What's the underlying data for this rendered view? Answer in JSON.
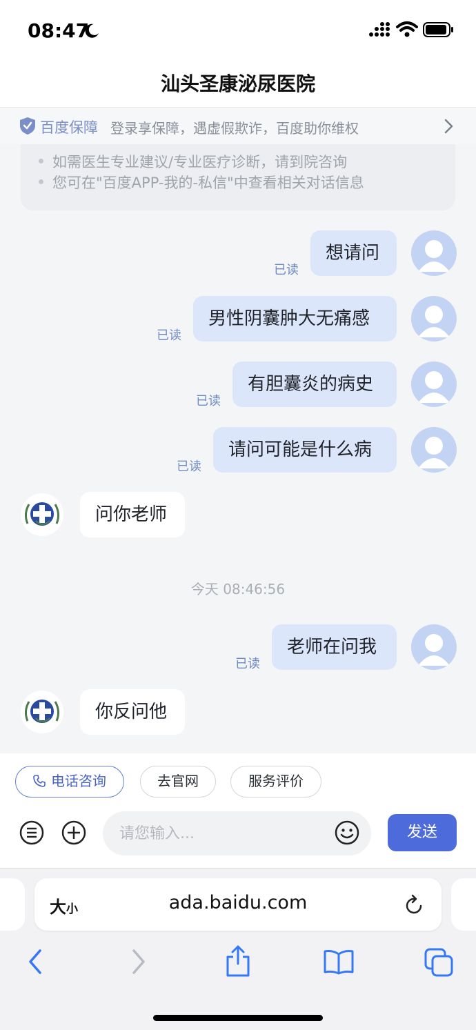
{
  "status_bar": {
    "time": "08:47"
  },
  "header": {
    "title": "汕头圣康泌尿医院"
  },
  "guarantee": {
    "brand": "百度保障",
    "text": "登录享保障，遇虚假欺诈，百度助你维权"
  },
  "notice": {
    "items": [
      "如需医生专业建议/专业医疗诊断，请到院咨询",
      "您可在\"百度APP-我的-私信\"中查看相关对话信息"
    ]
  },
  "chat": {
    "read_label": "已读",
    "timestamp": "今天 08:46:56",
    "messages": [
      {
        "from": "user",
        "text": "想请问"
      },
      {
        "from": "user",
        "text": "男性阴囊肿大无痛感"
      },
      {
        "from": "user",
        "text": "有胆囊炎的病史"
      },
      {
        "from": "user",
        "text": "请问可能是什么病"
      },
      {
        "from": "doctor",
        "text": "问你老师"
      },
      {
        "from": "user",
        "text": "老师在问我"
      },
      {
        "from": "doctor",
        "text": "你反问他"
      }
    ]
  },
  "quick_actions": {
    "phone": "电话咨询",
    "website": "去官网",
    "rating": "服务评价"
  },
  "composer": {
    "placeholder": "请您输入...",
    "send_label": "发送"
  },
  "browser": {
    "text_size_big": "大",
    "text_size_small": "小",
    "url": "ada.baidu.com"
  },
  "colors": {
    "accent": "#4e6bdc",
    "user_bubble": "#dbe6fb",
    "read_mark": "#6e8ac4"
  }
}
